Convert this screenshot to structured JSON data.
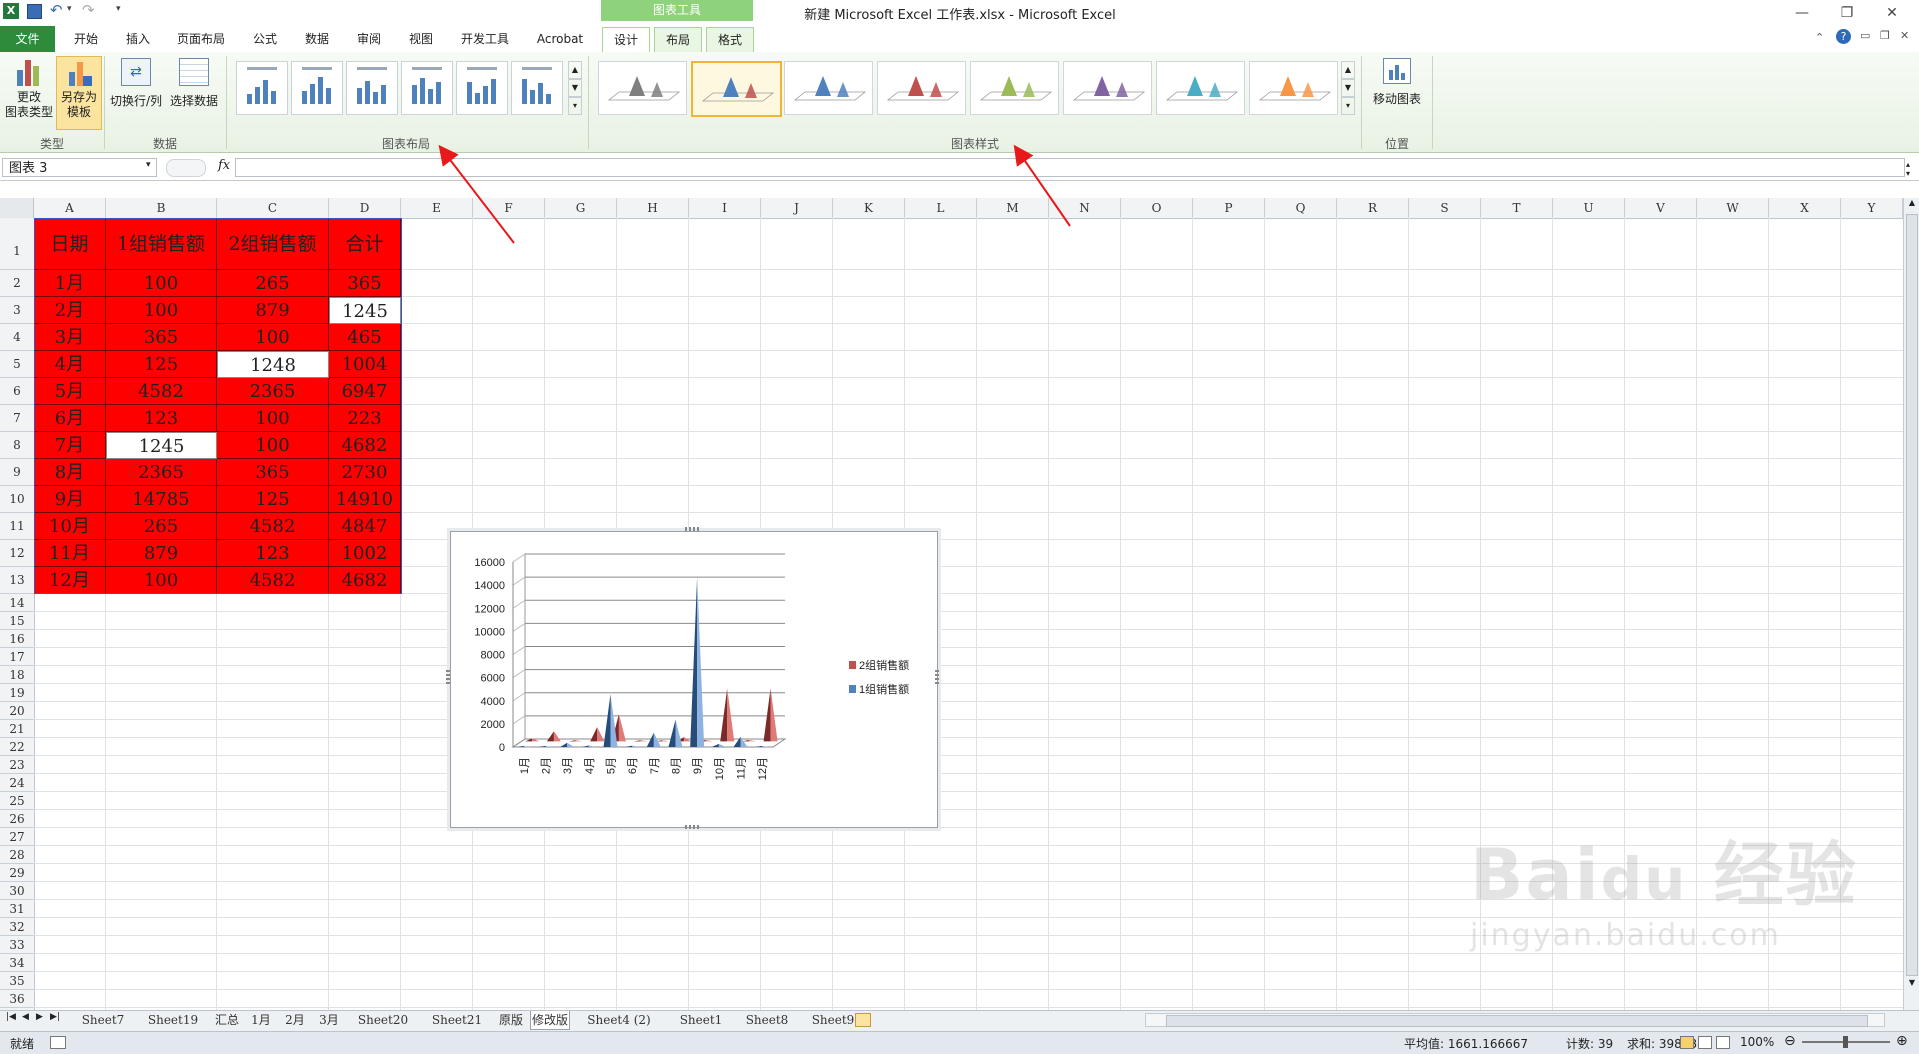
{
  "window": {
    "title": "新建 Microsoft Excel 工作表.xlsx  -  Microsoft Excel",
    "context_header": "图表工具",
    "quick_access": [
      "save-icon",
      "undo-icon",
      "redo-icon"
    ]
  },
  "tabs": [
    "文件",
    "开始",
    "插入",
    "页面布局",
    "公式",
    "数据",
    "审阅",
    "视图",
    "开发工具",
    "Acrobat"
  ],
  "context_tabs": [
    "设计",
    "布局",
    "格式"
  ],
  "ribbon": {
    "type_group": {
      "label": "类型",
      "change_type": "更改\n图表类型",
      "save_template": "另存为\n模板"
    },
    "data_group": {
      "label": "数据",
      "switch": "切换行/列",
      "select_data": "选择数据"
    },
    "layout_group": {
      "label": "图表布局"
    },
    "style_group": {
      "label": "图表样式"
    },
    "location_group": {
      "label": "位置",
      "move": "移动图表"
    },
    "style_colors": [
      "#7f7f7f",
      "#4f81bd",
      "#4f81bd",
      "#c0504d",
      "#9bbb59",
      "#8064a2",
      "#4bacc6",
      "#f79646"
    ]
  },
  "formula_bar": {
    "name_box": "图表 3",
    "fx": "fx",
    "formula": ""
  },
  "columns": [
    "A",
    "B",
    "C",
    "D",
    "E",
    "F",
    "G",
    "H",
    "I",
    "J",
    "K",
    "L",
    "M",
    "N",
    "O",
    "P",
    "Q",
    "R",
    "S",
    "T",
    "U",
    "V",
    "W",
    "X",
    "Y"
  ],
  "rows": [
    "1",
    "2",
    "3",
    "4",
    "5",
    "6",
    "7",
    "8",
    "9",
    "10",
    "11",
    "12",
    "13",
    "14",
    "15",
    "16",
    "17",
    "18",
    "19",
    "20",
    "21",
    "22",
    "23",
    "24",
    "25",
    "26",
    "27",
    "28",
    "29",
    "30",
    "31",
    "32",
    "33",
    "34",
    "35",
    "36"
  ],
  "table": {
    "headers": [
      "日期",
      "1组销售额",
      "2组销售额",
      "合计"
    ],
    "rows": [
      [
        "1月",
        "100",
        "265",
        "365"
      ],
      [
        "2月",
        "100",
        "879",
        "1245"
      ],
      [
        "3月",
        "365",
        "100",
        "465"
      ],
      [
        "4月",
        "125",
        "1248",
        "1004"
      ],
      [
        "5月",
        "4582",
        "2365",
        "6947"
      ],
      [
        "6月",
        "123",
        "100",
        "223"
      ],
      [
        "7月",
        "1245",
        "100",
        "4682"
      ],
      [
        "8月",
        "2365",
        "365",
        "2730"
      ],
      [
        "9月",
        "14785",
        "125",
        "14910"
      ],
      [
        "10月",
        "265",
        "4582",
        "4847"
      ],
      [
        "11月",
        "879",
        "123",
        "1002"
      ],
      [
        "12月",
        "100",
        "4582",
        "4682"
      ]
    ]
  },
  "chart_data": {
    "type": "bar",
    "categories": [
      "1月",
      "2月",
      "3月",
      "4月",
      "5月",
      "6月",
      "7月",
      "8月",
      "9月",
      "10月",
      "11月",
      "12月"
    ],
    "series": [
      {
        "name": "2组销售额",
        "color": "#c0504d",
        "values": [
          265,
          879,
          100,
          1248,
          2365,
          100,
          100,
          365,
          125,
          4582,
          123,
          4582
        ]
      },
      {
        "name": "1组销售额",
        "color": "#4f81bd",
        "values": [
          100,
          100,
          365,
          125,
          4582,
          123,
          1245,
          2365,
          14785,
          265,
          879,
          100
        ]
      }
    ],
    "ylim": [
      0,
      16000
    ],
    "yticks": [
      "16000",
      "14000",
      "12000",
      "10000",
      "8000",
      "6000",
      "4000",
      "2000",
      "0"
    ],
    "grid": true,
    "legend": "right"
  },
  "sheets": [
    "Sheet7",
    "Sheet19",
    "汇总",
    "1月",
    "2月",
    "3月",
    "Sheet20",
    "Sheet21",
    "原版",
    "修改版",
    "Sheet4 (2)",
    "Sheet1",
    "Sheet8",
    "Sheet9"
  ],
  "active_sheet": "修改版",
  "status": {
    "ready": "就绪",
    "average": "平均值: 1661.166667",
    "count": "计数: 39",
    "sum": "求和: 39868",
    "zoom": "100%"
  }
}
